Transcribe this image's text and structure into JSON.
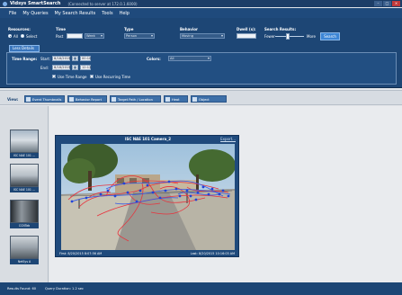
{
  "window": {
    "app_title": "Vidsys SmartSearch",
    "connection": "(Connected to server at 172.0.1.6000)"
  },
  "menu": [
    "File",
    "My Queries",
    "My Search Results",
    "Tools",
    "Help"
  ],
  "search": {
    "resources_label": "Resources:",
    "all_label": "All",
    "select_label": "Select",
    "time_label": "Time",
    "time_value": "Past",
    "time_unit": "Week",
    "type_label": "Type",
    "type_value": "Person",
    "behavior_label": "Behavior",
    "behavior_value": "Moving",
    "dwell_label": "Dwell (s):",
    "results_label": "Search Results:",
    "fewer_label": "Fewer",
    "more_label": "More",
    "search_button": "Search",
    "subtab": "Less Details",
    "time_range_label": "Time Range:",
    "start_label": "Start:",
    "start_date": "8/18/2015",
    "start_time": "00:10",
    "end_label": "End:",
    "end_date": "8/18/2015",
    "end_time": "12:12",
    "use_time_range": "Use Time Range",
    "use_recurring": "Use Recurring Time",
    "color_label": "Colors:",
    "color_value": "All"
  },
  "view": {
    "label": "View:",
    "buttons": [
      "Event Thumbnails",
      "Behavior Report",
      "Target Path / Location",
      "Heat Map",
      "Object Summary"
    ]
  },
  "thumbnails": [
    {
      "caption": "ISC NAE 101 ..."
    },
    {
      "caption": "ISC NAE 101 ..."
    },
    {
      "caption": "CCNTab"
    },
    {
      "caption": "NetSys A"
    }
  ],
  "player": {
    "title": "ISC NAE 101 Camera_2",
    "export": "Export...",
    "first": "First: 8/20/2015 8:07:56 AM",
    "last": "Last: 8/20/2015 10:16:03 AM"
  },
  "status": {
    "results_found": "Results Found: 60",
    "query_duration": "Query Duration: 1.2 sec"
  },
  "icons": {
    "app": "app-logo-icon",
    "calendar": "calendar-icon",
    "view": "view-icon"
  },
  "colors": {
    "panel": "#1d4675",
    "menu": "#1f4a7c",
    "accent": "#3d86d6",
    "path_red": "#e8323c",
    "path_blue": "#3357e6"
  }
}
